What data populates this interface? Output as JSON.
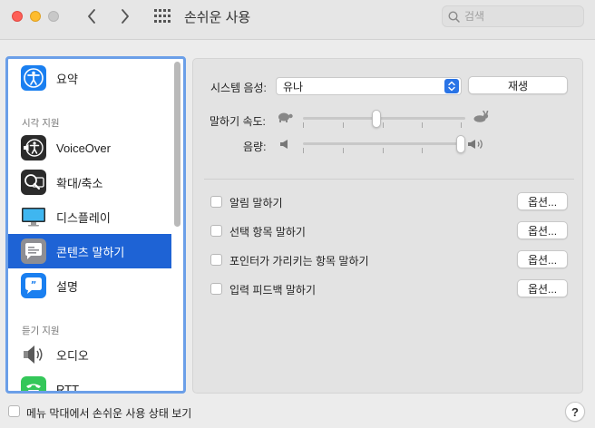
{
  "window": {
    "title": "손쉬운 사용"
  },
  "search": {
    "placeholder": "검색"
  },
  "sidebar": {
    "items": [
      {
        "label": "요약",
        "icon": "accessibility-icon"
      },
      {
        "label": "VoiceOver",
        "icon": "voiceover-icon"
      },
      {
        "label": "확대/축소",
        "icon": "zoom-icon"
      },
      {
        "label": "디스플레이",
        "icon": "display-icon"
      },
      {
        "label": "콘텐츠 말하기",
        "icon": "speech-bubble-icon",
        "selected": true
      },
      {
        "label": "설명",
        "icon": "descriptions-icon"
      },
      {
        "label": "오디오",
        "icon": "speaker-icon"
      },
      {
        "label": "RTT",
        "icon": "rtt-icon"
      }
    ],
    "sections": {
      "vision": "시각 지원",
      "hearing": "듣기 지원"
    }
  },
  "main": {
    "system_voice_label": "시스템 음성:",
    "system_voice_value": "유나",
    "play_button": "재생",
    "speaking_rate_label": "말하기 속도:",
    "speaking_rate_value": 0.45,
    "volume_label": "음량:",
    "volume_value": 1.0,
    "options": [
      {
        "label": "알림 말하기",
        "button": "옵션...",
        "checked": false
      },
      {
        "label": "선택 항목 말하기",
        "button": "옵션...",
        "checked": false
      },
      {
        "label": "포인터가 가리키는 항목 말하기",
        "button": "옵션...",
        "checked": false
      },
      {
        "label": "입력 피드백 말하기",
        "button": "옵션...",
        "checked": false
      }
    ]
  },
  "footer": {
    "menu_bar_label": "메뉴 막대에서 손쉬운 사용 상태 보기",
    "menu_bar_checked": false,
    "help": "?"
  },
  "colors": {
    "accent": "#1e63d5",
    "focus_ring": "#6b9fe8"
  }
}
